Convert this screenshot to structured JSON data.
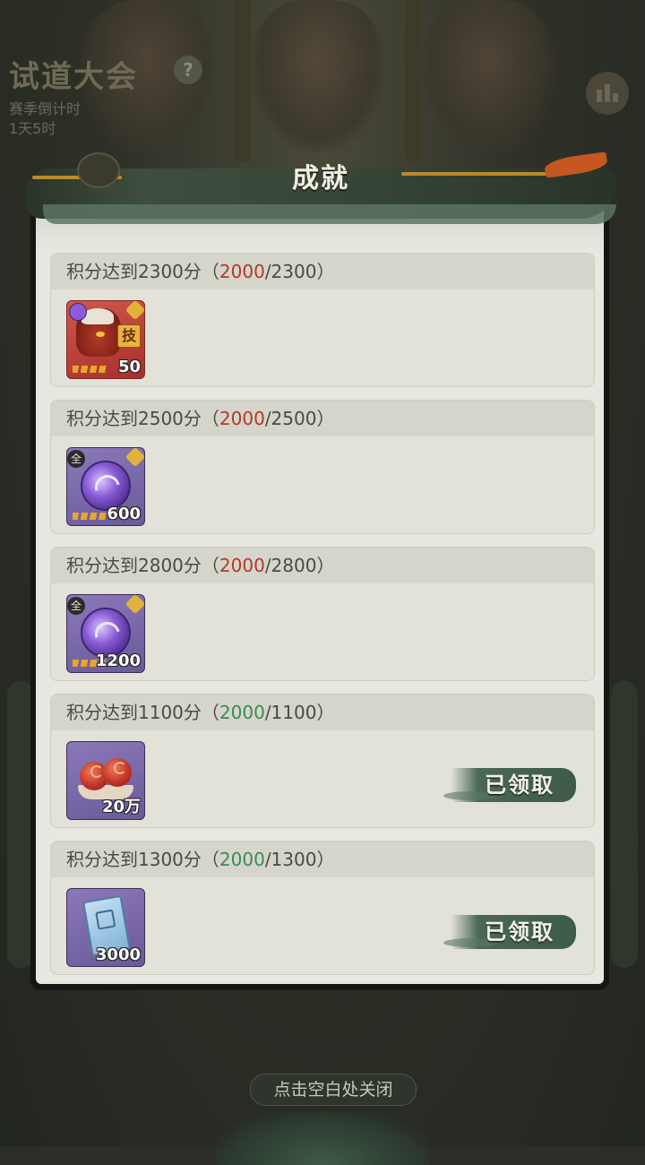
{
  "background": {
    "event_title": "试道大会",
    "help_symbol": "?",
    "season_label": "赛季倒计时",
    "season_remaining": "1天5时"
  },
  "panel": {
    "title": "成就"
  },
  "achievements": [
    {
      "prefix": "积分达到2300分（",
      "current": "2000",
      "sep_target": "/2300）",
      "status_color": "red",
      "item": {
        "kind": "character",
        "icon": "hero-portrait-icon",
        "skill_badge": "技",
        "quantity": "50"
      },
      "claimed": false
    },
    {
      "prefix": "积分达到2500分（",
      "current": "2000",
      "sep_target": "/2500）",
      "status_color": "red",
      "item": {
        "kind": "orb",
        "icon": "spirit-orb-icon",
        "all_badge": "全",
        "quantity": "600"
      },
      "claimed": false
    },
    {
      "prefix": "积分达到2800分（",
      "current": "2000",
      "sep_target": "/2800）",
      "status_color": "red",
      "item": {
        "kind": "orb",
        "icon": "spirit-orb-icon",
        "all_badge": "全",
        "quantity": "1200"
      },
      "claimed": false
    },
    {
      "prefix": "积分达到1100分（",
      "current": "2000",
      "sep_target": "/1100）",
      "status_color": "green",
      "item": {
        "kind": "peach",
        "icon": "peach-icon",
        "quantity": "20万"
      },
      "claimed": true,
      "claimed_label": "已领取"
    },
    {
      "prefix": "积分达到1300分（",
      "current": "2000",
      "sep_target": "/1300）",
      "status_color": "green",
      "item": {
        "kind": "token",
        "icon": "jade-token-icon",
        "quantity": "3000"
      },
      "claimed": true,
      "claimed_label": "已领取"
    }
  ],
  "close_hint": "点击空白处关闭",
  "colors": {
    "not_reached": "#b23a2a",
    "reached": "#3b8a5a",
    "claimed_button": "#4b6855"
  }
}
